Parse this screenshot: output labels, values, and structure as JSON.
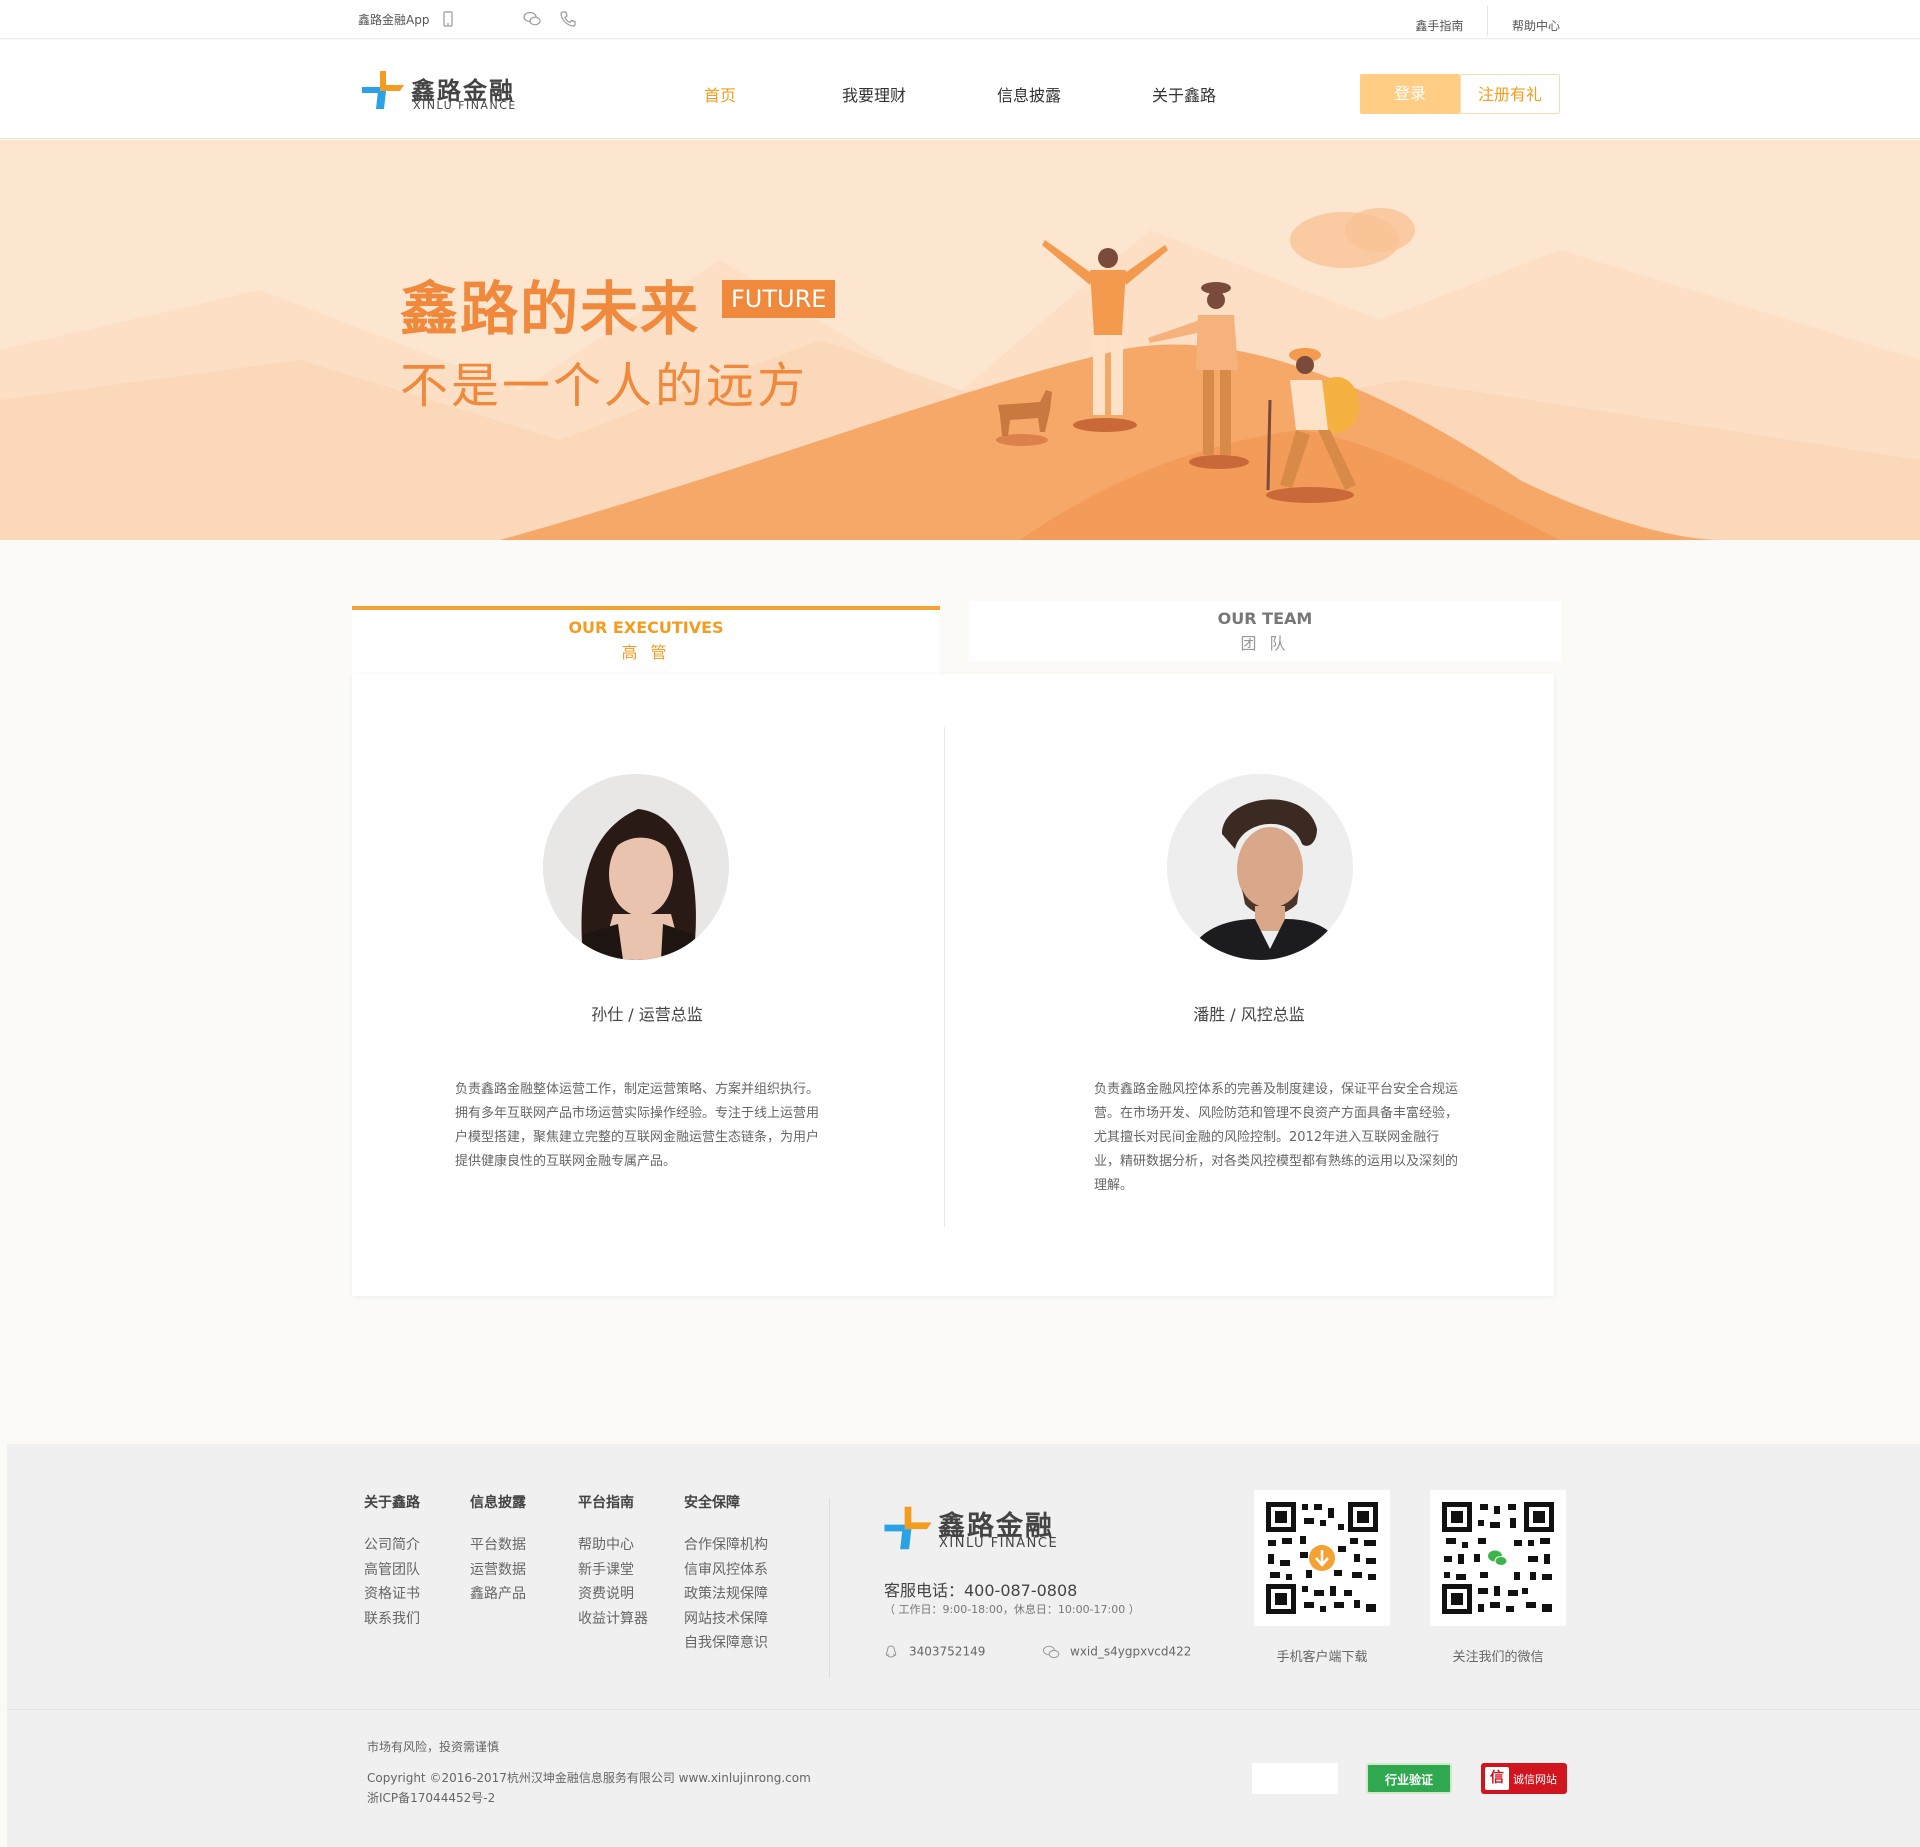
{
  "topbar": {
    "app_label": "鑫路金融App",
    "guide_label": "鑫手指南",
    "help_label": "帮助中心"
  },
  "header": {
    "logo_cn": "鑫路金融",
    "logo_en": "XINLU FINANCE",
    "nav": [
      "首页",
      "我要理财",
      "信息披露",
      "关于鑫路"
    ],
    "active_nav": "首页",
    "login_label": "登录",
    "register_label": "注册有礼"
  },
  "banner": {
    "title": "鑫路的未来",
    "tag": "FUTURE",
    "subtitle": "不是一个人的远方"
  },
  "tabs": {
    "executives_en": "OUR EXECUTIVES",
    "executives_cn": "高 管",
    "team_en": "OUR TEAM",
    "team_cn": "团 队"
  },
  "executives": [
    {
      "name": "孙仕",
      "title": "运营总监",
      "name_line": "孙仕  /  运营总监",
      "desc": "负责鑫路金融整体运营工作，制定运营策略、方案并组织执行。拥有多年互联网产品市场运营实际操作经验。专注于线上运营用户模型搭建，聚焦建立完整的互联网金融运营生态链条，为用户提供健康良性的互联网金融专属产品。"
    },
    {
      "name": "潘胜",
      "title": "风控总监",
      "name_line": "潘胜  /  风控总监",
      "desc": "负责鑫路金融风控体系的完善及制度建设，保证平台安全合规运营。在市场开发、风险防范和管理不良资产方面具备丰富经验，尤其擅长对民间金融的风险控制。2012年进入互联网金融行业，精研数据分析，对各类风控模型都有熟练的运用以及深刻的理解。"
    }
  ],
  "footer": {
    "columns": [
      {
        "title": "关于鑫路",
        "links": [
          "公司简介",
          "高管团队",
          "资格证书",
          "联系我们"
        ]
      },
      {
        "title": "信息披露",
        "links": [
          "平台数据",
          "运营数据",
          "鑫路产品"
        ]
      },
      {
        "title": "平台指南",
        "links": [
          "帮助中心",
          "新手课堂",
          "资费说明",
          "收益计算器"
        ]
      },
      {
        "title": "安全保障",
        "links": [
          "合作保障机构",
          "信审风控体系",
          "政策法规保障",
          "网站技术保障",
          "自我保障意识"
        ]
      }
    ],
    "logo_cn": "鑫路金融",
    "logo_en": "XINLU FINANCE",
    "phone": "客服电话：400-087-0808",
    "hours": "（ 工作日：9:00-18:00，休息日：10:00-17:00 ）",
    "qq": "3403752149",
    "wechat": "wxid_s4ygpxvcd422",
    "qr_app_label": "手机客户端下载",
    "qr_wechat_label": "关注我们的微信",
    "risk": "市场有风险，投资需谨慎",
    "copyright": "Copyright ©2016-2017杭州汉坤金融信息服务有限公司 www.xinlujinrong.com",
    "icp": "浙ICP备17044452号-2",
    "badge_verify": "行业验证",
    "badge_credit": "诚信网站"
  },
  "colors": {
    "accent": "#f39c1f",
    "banner_text": "#f0893b",
    "banner_bg": "#fde6cf",
    "login_bg": "#ffcd84"
  }
}
